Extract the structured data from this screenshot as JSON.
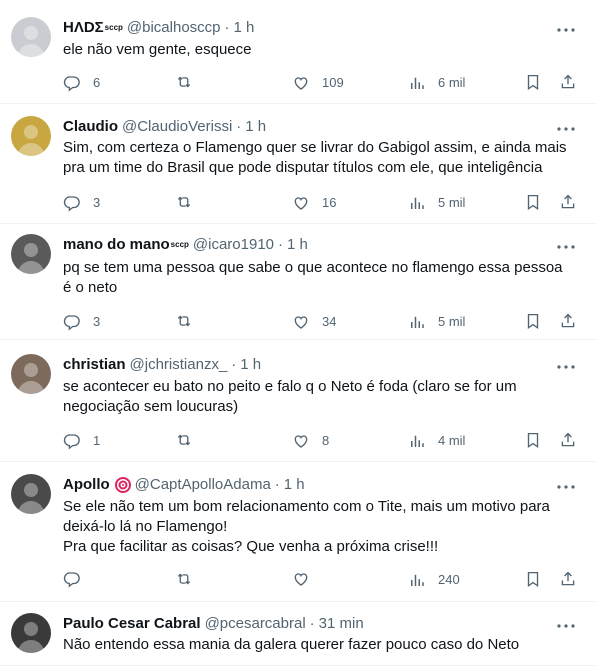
{
  "tweets": [
    {
      "name": "ΗΛDΣ",
      "name_badge": "sccp",
      "handle": "@bicalhosccp",
      "time": "1 h",
      "lines": [
        "ele não vem gente, esquece"
      ],
      "replies": "6",
      "retweets": "",
      "likes": "109",
      "views": "6 mil",
      "avatar_color": "#c9ccd0"
    },
    {
      "name": "Claudio",
      "handle": "@ClaudioVerissi",
      "time": "1 h",
      "lines": [
        "Sim, com certeza o Flamengo quer se livrar do Gabigol assim, e ainda mais",
        "pra um time do Brasil que pode disputar títulos com ele, que inteligência"
      ],
      "replies": "3",
      "retweets": "",
      "likes": "16",
      "views": "5 mil",
      "avatar_color": "#c8a640"
    },
    {
      "name": "mano do mano",
      "name_badge": "sccp",
      "handle": "@icaro1910",
      "time": "1 h",
      "lines": [
        "pq se tem uma pessoa que sabe o que acontece no flamengo essa pessoa",
        "é o neto"
      ],
      "replies": "3",
      "retweets": "",
      "likes": "34",
      "views": "5 mil",
      "avatar_color": "#5a5a5a"
    },
    {
      "name": "christian",
      "handle": "@jchristianzx_",
      "time": "1 h",
      "lines": [
        "se acontecer eu bato no peito e falo q o Neto é foda (claro se for um",
        "negociação sem loucuras)"
      ],
      "replies": "1",
      "retweets": "",
      "likes": "8",
      "views": "4 mil",
      "avatar_color": "#7d6a5c"
    },
    {
      "name": "Apollo",
      "handle": "@CaptApolloAdama",
      "time": "1 h",
      "lines": [
        "Se ele não tem um bom relacionamento com o Tite, mais um motivo para",
        "deixá-lo lá no Flamengo!",
        "Pra que facilitar as coisas? Que venha a próxima crise!!!"
      ],
      "replies": "",
      "retweets": "",
      "likes": "",
      "views": "240",
      "avatar_color": "#4a4a4a",
      "has_emoji": true
    },
    {
      "name": "Paulo Cesar Cabral",
      "handle": "@pcesarcabral",
      "time": "31 min",
      "lines": [
        "Não entendo essa mania da galera querer fazer pouco caso do Neto"
      ],
      "avatar_color": "#3a3a3a"
    }
  ],
  "icons": {
    "reply": "reply-icon",
    "retweet": "retweet-icon",
    "like": "like-icon",
    "views": "views-icon",
    "bookmark": "bookmark-icon",
    "share": "share-icon",
    "more": "more-icon"
  },
  "colors": {
    "text": "#0f1419",
    "secondary": "#536471",
    "divider": "#eff3f4",
    "emoji_target": "#e0245e"
  }
}
